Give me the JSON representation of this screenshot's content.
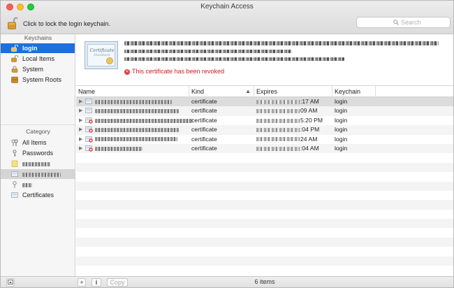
{
  "window": {
    "title": "Keychain Access"
  },
  "toolbar": {
    "lock_label": "Click to lock the login keychain.",
    "search_placeholder": "Search"
  },
  "sidebar": {
    "keychains_header": "Keychains",
    "keychains": [
      {
        "label": "login",
        "selected": true
      },
      {
        "label": "Local Items"
      },
      {
        "label": "System"
      },
      {
        "label": "System Roots"
      }
    ],
    "category_header": "Category",
    "categories": [
      {
        "label": "All Items"
      },
      {
        "label": "Passwords"
      },
      {
        "label": ""
      },
      {
        "label": "",
        "selected": true
      },
      {
        "label": ""
      },
      {
        "label": "Certificates"
      }
    ]
  },
  "detail": {
    "thumb_caption": "Certificate",
    "thumb_sub": "Standard",
    "status": "This certificate has been revoked",
    "status_color": "#d11d1d"
  },
  "table": {
    "columns": {
      "name": "Name",
      "kind": "Kind",
      "expires": "Expires",
      "keychain": "Keychain"
    },
    "rows": [
      {
        "icon": "certificate-icon",
        "kind": "certificate",
        "expires_suffix": ":17 AM",
        "keychain": "login",
        "selected": true
      },
      {
        "icon": "certificate-icon",
        "kind": "certificate",
        "expires_suffix": "09 AM",
        "keychain": "login"
      },
      {
        "icon": "revoked-certificate-icon",
        "kind": "certificate",
        "expires_suffix": "5:20 PM",
        "keychain": "login"
      },
      {
        "icon": "revoked-certificate-icon",
        "kind": "certificate",
        "expires_suffix": ":04 PM",
        "keychain": "login"
      },
      {
        "icon": "revoked-certificate-icon",
        "kind": "certificate",
        "expires_suffix": "24 AM",
        "keychain": "login"
      },
      {
        "icon": "revoked-certificate-icon",
        "kind": "certificate",
        "expires_suffix": ":04 AM",
        "keychain": "login"
      }
    ]
  },
  "bottom": {
    "add": "+",
    "info": "i",
    "copy": "Copy",
    "count": "6 items"
  }
}
